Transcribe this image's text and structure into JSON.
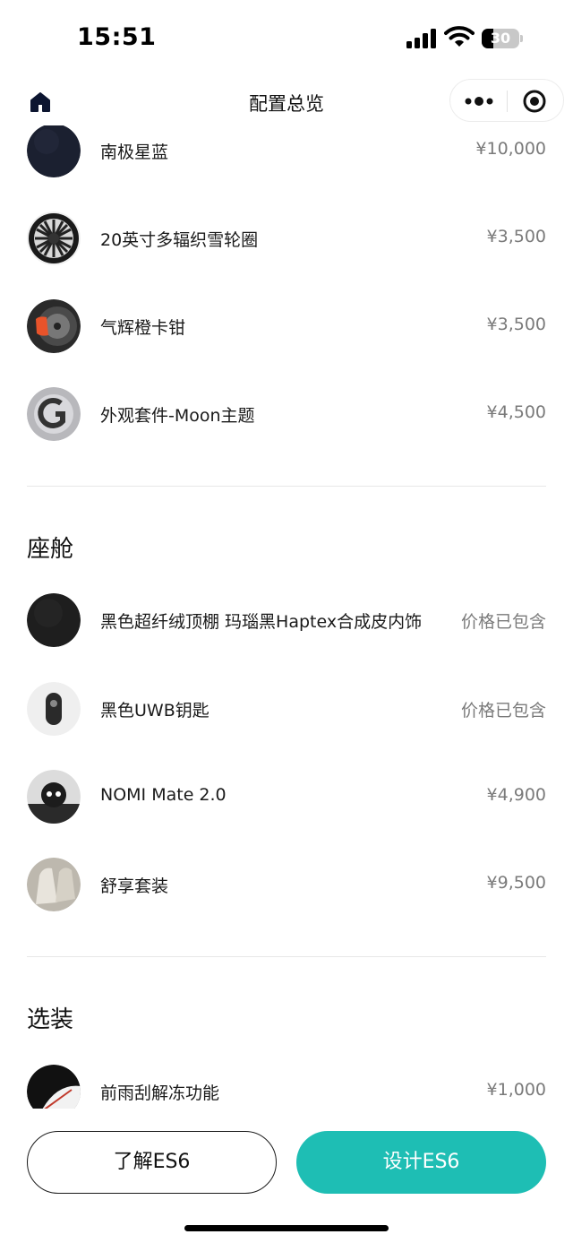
{
  "status_bar": {
    "time": "15:51",
    "battery": "30"
  },
  "nav": {
    "title": "配置总览"
  },
  "exterior": {
    "items": [
      {
        "name": "南极星蓝",
        "price": "¥10,000"
      },
      {
        "name": "20英寸多辐织雪轮圈",
        "price": "¥3,500"
      },
      {
        "name": "气辉橙卡钳",
        "price": "¥3,500"
      },
      {
        "name": "外观套件-Moon主题",
        "price": "¥4,500"
      }
    ]
  },
  "cabin": {
    "title": "座舱",
    "items": [
      {
        "name": "黑色超纤绒顶棚 玛瑙黑Haptex合成皮内饰",
        "price": "价格已包含"
      },
      {
        "name": "黑色UWB钥匙",
        "price": "价格已包含"
      },
      {
        "name": "NOMI Mate 2.0",
        "price": "¥4,900"
      },
      {
        "name": "舒享套装",
        "price": "¥9,500"
      }
    ]
  },
  "options": {
    "title": "选装",
    "items": [
      {
        "name": "前雨刮解冻功能",
        "price": "¥1,000"
      }
    ]
  },
  "actions": {
    "learn_label": "了解ES6",
    "design_label": "设计ES6"
  },
  "colors": {
    "accent": "#1ebeb4",
    "text": "#1a1a1a",
    "price": "#7a7a7a",
    "divider": "#e8e8e8"
  }
}
